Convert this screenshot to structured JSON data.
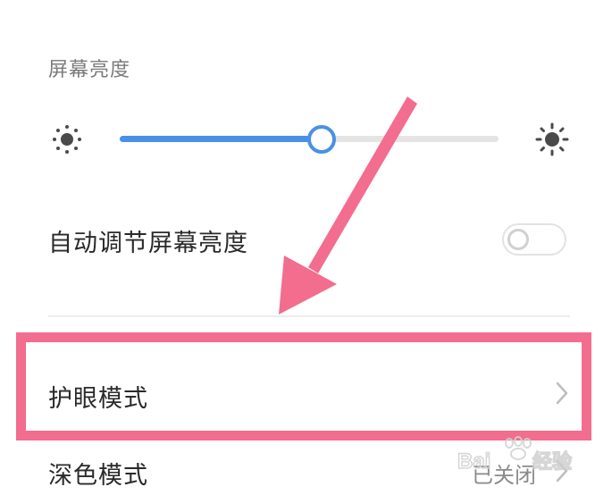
{
  "brightness": {
    "section_label": "屏幕亮度",
    "level": 0.53
  },
  "auto_brightness": {
    "label": "自动调节屏幕亮度",
    "enabled": false
  },
  "eye_comfort": {
    "label": "护眼模式"
  },
  "dark_mode": {
    "label": "深色模式",
    "value": "已关闭"
  },
  "colors": {
    "accent": "#4a90e6",
    "highlight": "#f26d8e",
    "arrow": "#f26d8e"
  },
  "icons": {
    "brightness_low": "sun-small-icon",
    "brightness_high": "sun-large-icon",
    "row_chevron": "chevron-right-icon"
  }
}
